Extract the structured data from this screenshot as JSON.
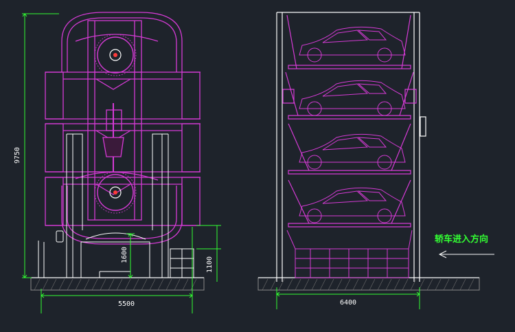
{
  "drawing": {
    "background": "#1e232b",
    "colors": {
      "frame": "#d63bd6",
      "structure": "#ffffff",
      "dimension": "#33ff33",
      "ground": "#8a8a8a"
    },
    "side_view": {
      "dim_height": "9750",
      "dim_width": "5500",
      "dim_pit": "1600",
      "dim_entry": "1100"
    },
    "front_view": {
      "dim_width": "6400",
      "entry_direction_label": "轿车进入方向"
    }
  }
}
